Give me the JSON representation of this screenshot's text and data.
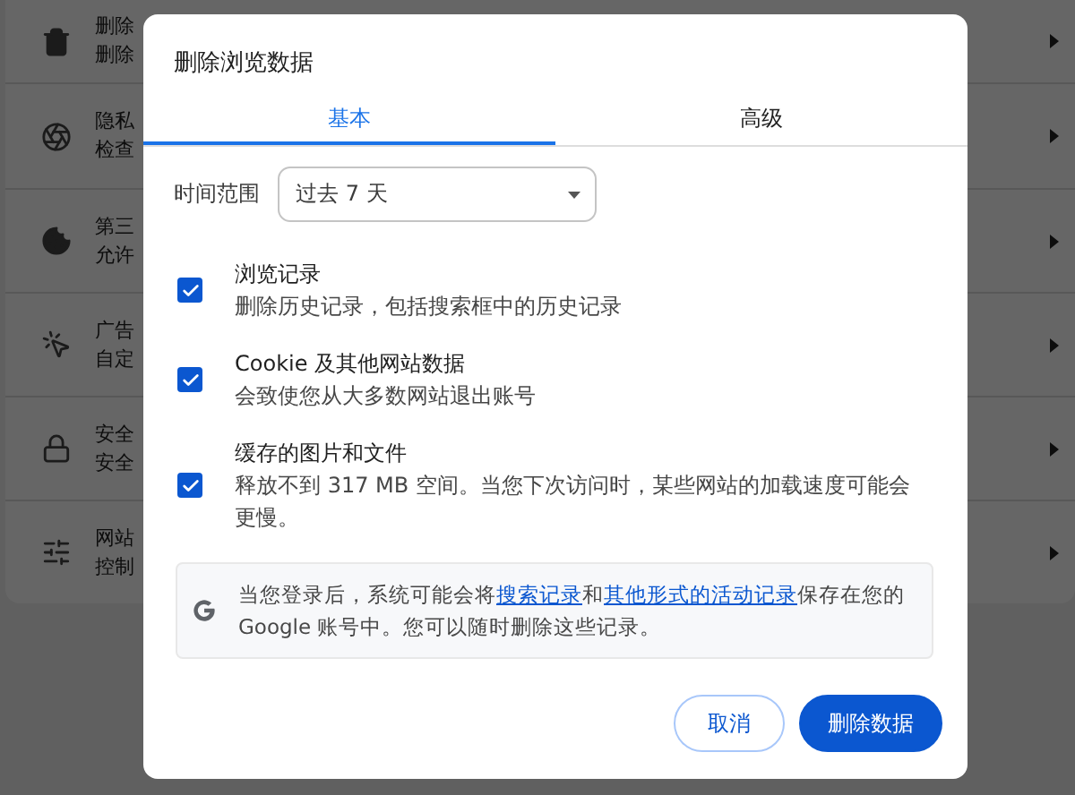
{
  "background_settings": {
    "rows": [
      {
        "title": "删除",
        "subtitle": "删除"
      },
      {
        "title": "隐私",
        "subtitle": "检查"
      },
      {
        "title": "第三",
        "subtitle": "允许"
      },
      {
        "title": "广告",
        "subtitle": "自定"
      },
      {
        "title": "安全",
        "subtitle": "安全"
      },
      {
        "title": "网站",
        "subtitle": "控制"
      }
    ]
  },
  "dialog": {
    "title": "删除浏览数据",
    "tabs": [
      {
        "label": "基本",
        "selected": true
      },
      {
        "label": "高级",
        "selected": false
      }
    ],
    "time_range": {
      "label": "时间范围",
      "value": "过去 7 天"
    },
    "options": [
      {
        "title": "浏览记录",
        "description": "删除历史记录，包括搜索框中的历史记录",
        "checked": true
      },
      {
        "title": "Cookie 及其他网站数据",
        "description": "会致使您从大多数网站退出账号",
        "checked": true
      },
      {
        "title": "缓存的图片和文件",
        "description": "释放不到 317 MB 空间。当您下次访问时，某些网站的加载速度可能会更慢。",
        "checked": true
      }
    ],
    "info": {
      "parts": [
        {
          "kind": "text",
          "text": "当您登录后，系统可能会将"
        },
        {
          "kind": "link",
          "text": "搜索记录"
        },
        {
          "kind": "text",
          "text": "和"
        },
        {
          "kind": "link",
          "text": "其他形式的活动记录"
        },
        {
          "kind": "text",
          "text": "保存在您的 Google 账号中。您可以随时删除这些记录。"
        }
      ]
    },
    "buttons": [
      {
        "kind": "secondary",
        "label": "取消"
      },
      {
        "kind": "primary",
        "label": "删除数据"
      }
    ]
  }
}
